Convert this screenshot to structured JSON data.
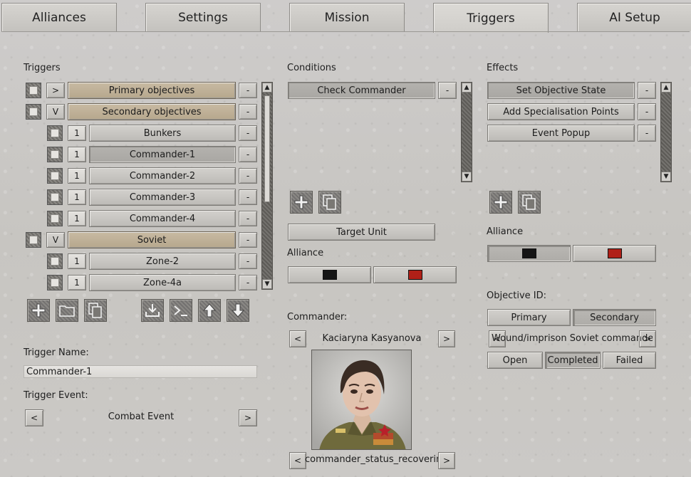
{
  "tabs": [
    {
      "label": "Alliances"
    },
    {
      "label": "Settings"
    },
    {
      "label": "Mission"
    },
    {
      "label": "Triggers",
      "active": true
    },
    {
      "label": "AI Setup"
    }
  ],
  "triggers": {
    "title": "Triggers",
    "remove_label": "-",
    "rows": [
      {
        "kind": "group",
        "toggle": ">",
        "label": "Primary objectives"
      },
      {
        "kind": "group",
        "toggle": "V",
        "label": "Secondary objectives"
      },
      {
        "kind": "child",
        "num": "1",
        "label": "Bunkers"
      },
      {
        "kind": "child",
        "num": "1",
        "label": "Commander-1",
        "selected": true
      },
      {
        "kind": "child",
        "num": "1",
        "label": "Commander-2"
      },
      {
        "kind": "child",
        "num": "1",
        "label": "Commander-3"
      },
      {
        "kind": "child",
        "num": "1",
        "label": "Commander-4"
      },
      {
        "kind": "group",
        "toggle": "V",
        "label": "Soviet"
      },
      {
        "kind": "child",
        "num": "1",
        "label": "Zone-2"
      },
      {
        "kind": "child",
        "num": "1",
        "label": "Zone-4a"
      }
    ],
    "toolbar_icons": [
      "add-icon",
      "folder-icon",
      "copy-icon",
      "import-icon",
      "console-icon",
      "arrow-up-icon",
      "arrow-down-icon"
    ]
  },
  "trigger_name": {
    "label": "Trigger Name:",
    "value": "Commander-1"
  },
  "trigger_event": {
    "label": "Trigger Event:",
    "prev": "<",
    "next": ">",
    "value": "Combat Event"
  },
  "conditions": {
    "title": "Conditions",
    "items": [
      {
        "label": "Check Commander",
        "selected": true
      }
    ],
    "remove_label": "-",
    "target_unit": "Target Unit",
    "alliance_label": "Alliance",
    "alliance_colors": [
      "#151515",
      "#b02018"
    ],
    "commander_label": "Commander:",
    "prev": "<",
    "next": ">",
    "commander_name": "Kaciaryna Kasyanova",
    "status_value": "commander_status_recovering"
  },
  "effects": {
    "title": "Effects",
    "remove_label": "-",
    "items": [
      {
        "label": "Set Objective State",
        "selected": true
      },
      {
        "label": "Add Specialisation Points"
      },
      {
        "label": "Event Popup"
      }
    ],
    "alliance_label": "Alliance",
    "alliance_colors": [
      "#151515",
      "#b02018"
    ],
    "objective_id_label": "Objective ID:",
    "objective_types": [
      "Primary",
      "Secondary"
    ],
    "objective_selected": "Secondary",
    "prev": "<",
    "next": ">",
    "objective_name": "Wound/imprison Soviet commanders",
    "states": [
      "Open",
      "Completed",
      "Failed"
    ],
    "state_selected": "Completed"
  }
}
